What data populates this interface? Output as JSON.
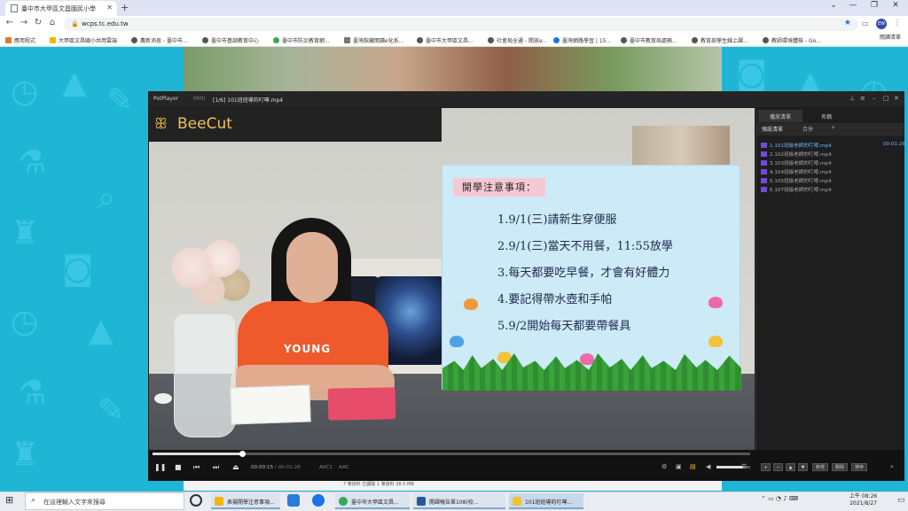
{
  "browser": {
    "tab_title": "臺中市大甲區文昌國民小學",
    "new_tab": "+",
    "url": "wcps.tc.edu.tw",
    "avatar_text": "EW",
    "reading_list": "閱讀清單",
    "bookmarks": [
      "應用程式",
      "大甲區文昌國小共用雲端",
      "農新消息 - 臺中市...",
      "臺中市基調教育中心",
      "臺中市防災教育網...",
      "臺灣館藏閱讀e化系...",
      "臺中市大甲區文昌...",
      "社會局全通 - 開放e...",
      "臺灣網路學習 | 15...",
      "臺中市教育局處務...",
      "教育部學生線上課...",
      "教師環境體檢 - Go..."
    ]
  },
  "player": {
    "app_name": "PotPlayer",
    "mini_label": "MINI",
    "file_title": "[1/6] 101班班導的叮嚀.mp4",
    "logo_text": "BeeCut",
    "time_current": "00:00:15",
    "time_total": "00:01:28",
    "format_a": "AVC1",
    "format_b": "AAC",
    "progress_fraction": 0.15,
    "volume_fraction": 0.8
  },
  "slide": {
    "title": "開學注意事項：",
    "lines": [
      "1.9/1(三)請新生穿便服",
      "2.9/1(三)當天不用餐，11:55放學",
      "3.每天都要吃早餐，才會有好體力",
      "4.要記得帶水壺和手帕",
      "5.9/2開始每天都要帶餐具"
    ]
  },
  "video": {
    "shirt_text": "YOUNG"
  },
  "playlist": {
    "tabs": [
      "播放清單",
      "名稱"
    ],
    "sub_tabs": [
      "預設清單",
      "合併",
      "+"
    ],
    "items": [
      {
        "name": "1.101班級老師的叮嚀.mp4",
        "duration": "00:01:28"
      },
      {
        "name": "2.102班級老師的叮嚀.mp4",
        "duration": ""
      },
      {
        "name": "3.103班級老師的叮嚀.mp4",
        "duration": ""
      },
      {
        "name": "4.104班級老師的叮嚀.mp4",
        "duration": ""
      },
      {
        "name": "5.105班級老師的叮嚀.mp4",
        "duration": ""
      },
      {
        "name": "6.107班級老師的叮嚀.mp4",
        "duration": ""
      }
    ],
    "buttons": [
      "新增",
      "刪除",
      "排序"
    ]
  },
  "page_strip": "7 筆資料    已讀取 1 筆資料    38.5 MB",
  "taskbar": {
    "search_placeholder": "在這裡輸入文字來搜尋",
    "apps": [
      "表揚開學注意事項...",
      "臺中市大甲區文昌...",
      "開課報告單108(校...",
      "101班班導的叮嚀..."
    ],
    "clock_time": "上午 08:26",
    "clock_date": "2021/8/27"
  },
  "colors": {
    "page_bg": "#1fb6d6",
    "player_bg": "#1c1c1c",
    "slide_bg": "#cdeaf7",
    "slide_title_bg": "#f6c8d6",
    "playlist_active": "#6db3ff"
  }
}
